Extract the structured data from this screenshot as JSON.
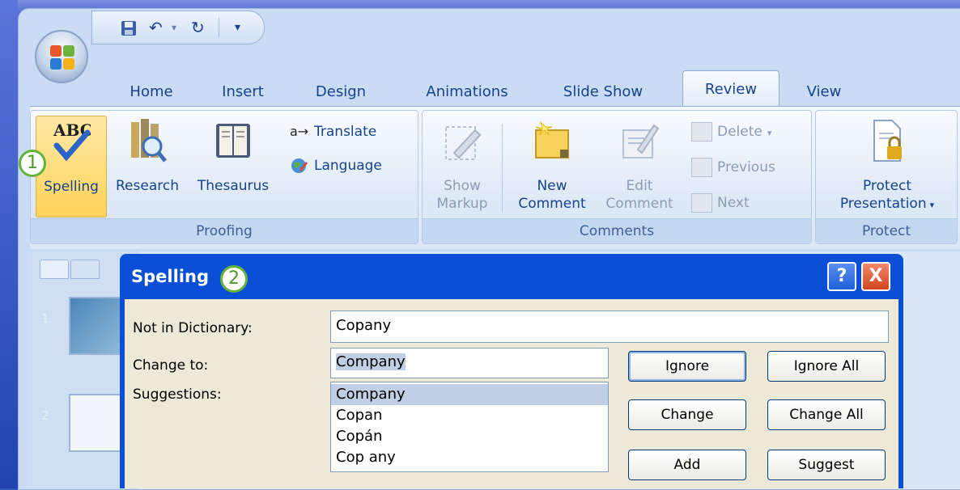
{
  "tabs": [
    "Home",
    "Insert",
    "Design",
    "Animations",
    "Slide Show",
    "Review",
    "View"
  ],
  "active_tab": "Review",
  "ribbon": {
    "proofing": {
      "label": "Proofing",
      "spelling": "Spelling",
      "research": "Research",
      "thesaurus": "Thesaurus",
      "translate": "Translate",
      "language": "Language"
    },
    "comments": {
      "label": "Comments",
      "show_markup_1": "Show",
      "show_markup_2": "Markup",
      "new_comment_1": "New",
      "new_comment_2": "Comment",
      "edit_comment_1": "Edit",
      "edit_comment_2": "Comment",
      "delete": "Delete",
      "previous": "Previous",
      "next": "Next"
    },
    "protect": {
      "label": "Protect",
      "protect_1": "Protect",
      "protect_2": "Presentation"
    }
  },
  "callouts": {
    "one": "1",
    "two": "2"
  },
  "slides": {
    "first": "1",
    "second": "2"
  },
  "dialog": {
    "title": "Spelling",
    "help": "?",
    "close": "X",
    "not_in_dict_label": "Not in Dictionary:",
    "not_in_dict_value": "Copany",
    "change_to_label": "Change to:",
    "change_to_value": "Company",
    "suggestions_label": "Suggestions:",
    "suggestions": [
      "Company",
      "Copan",
      "Copán",
      "Cop any"
    ],
    "buttons": {
      "ignore": "Ignore",
      "ignore_all": "Ignore All",
      "change": "Change",
      "change_all": "Change All",
      "add": "Add",
      "suggest": "Suggest"
    }
  },
  "colors": {
    "accent": "#0b4fd6",
    "tab_text": "#15428b",
    "callout": "#63b33a"
  }
}
